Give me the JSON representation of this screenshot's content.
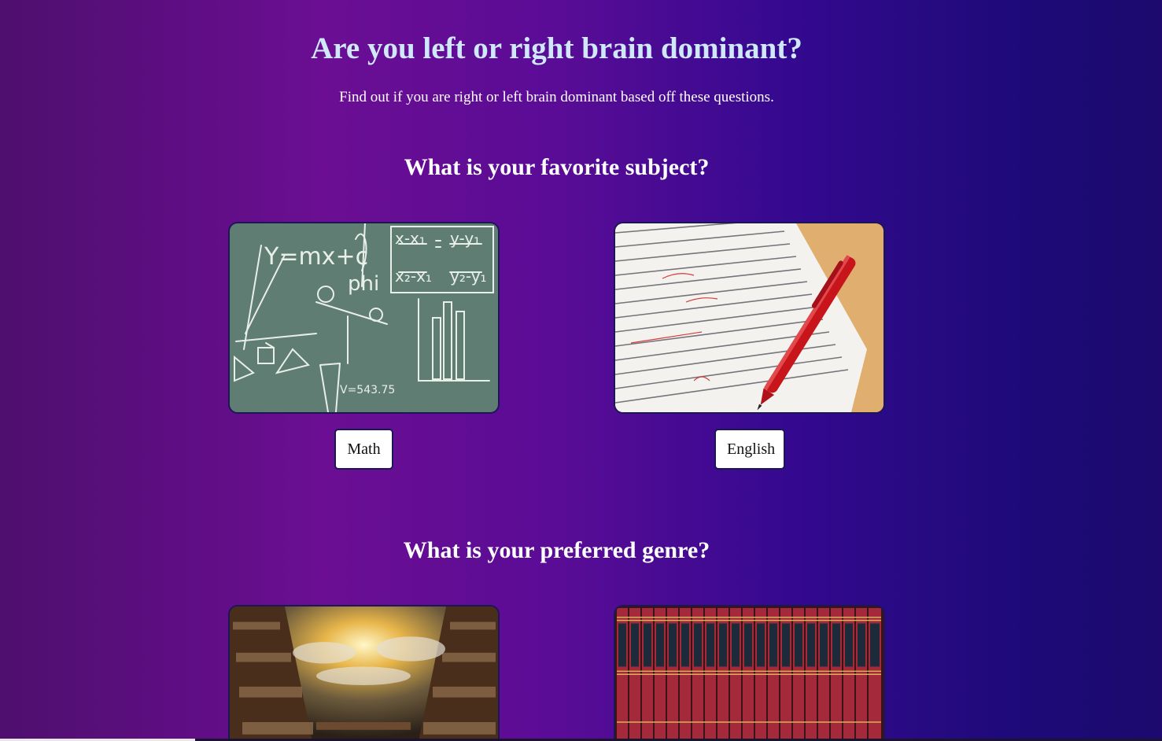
{
  "page": {
    "title": "Are you left or right brain dominant?",
    "subtitle": "Find out if you are right or left brain dominant based off these questions."
  },
  "questions": [
    {
      "prompt": "What is your favorite subject?",
      "options": [
        {
          "label": "Math",
          "image": "chalkboard-math-image"
        },
        {
          "label": "English",
          "image": "essay-with-red-pen-image"
        }
      ]
    },
    {
      "prompt": "What is your preferred genre?",
      "options": [
        {
          "image": "fantasy-library-image"
        },
        {
          "image": "encyclopedia-books-image"
        }
      ]
    }
  ],
  "chalkboard_text": {
    "equation": "Y=mx+c",
    "greek": "phi",
    "value": "V=543.75"
  },
  "colors": {
    "title": "#cfe8fb",
    "border": "#1c1655",
    "chalkboard": "#5f7d72",
    "pen": "#c8151c",
    "book_spine": "#a4293a"
  }
}
